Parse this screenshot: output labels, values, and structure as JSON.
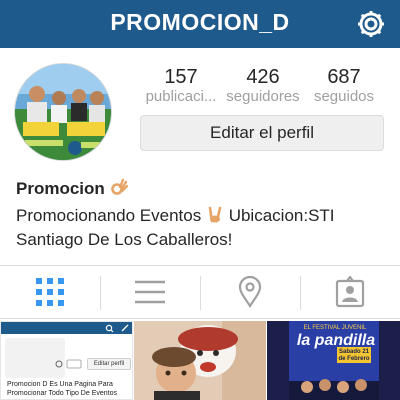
{
  "header": {
    "title": "PROMOCION_D",
    "settings_icon": "gear-icon"
  },
  "profile": {
    "stats": [
      {
        "value": "157",
        "label": "publicaci..."
      },
      {
        "value": "426",
        "label": "seguidores"
      },
      {
        "value": "687",
        "label": "seguidos"
      }
    ],
    "edit_button": "Editar el perfil",
    "name": "Promocion",
    "bio_line1": "Promocionando Eventos",
    "bio_line1b": "Ubicacion:STI",
    "bio_line2": "Santiago De Los Caballeros!"
  },
  "tabs": [
    {
      "icon": "grid-view-icon",
      "active": true
    },
    {
      "icon": "list-view-icon",
      "active": false
    },
    {
      "icon": "location-pin-icon",
      "active": false
    },
    {
      "icon": "tagged-photos-icon",
      "active": false
    }
  ],
  "posts": [
    {
      "edit_label": "Editar perfil",
      "caption": "Promocion D Es Una Pagina Para Promocionar Todo Tipo De Eventos"
    },
    {},
    {
      "poster_title": "la pandilla",
      "poster_sub": "EL FESTIVAL JUVENIL",
      "poster_date": "Sabado 21 de Febrero"
    }
  ],
  "colors": {
    "header_bg": "#1f5a8c",
    "accent": "#3897f0",
    "muted": "#a0a0a0"
  }
}
